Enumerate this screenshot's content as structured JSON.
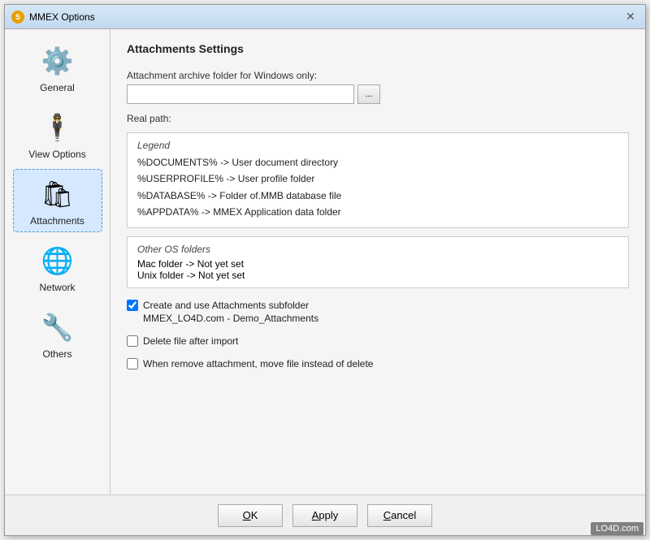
{
  "window": {
    "title": "MMEX Options",
    "close_label": "✕"
  },
  "sidebar": {
    "items": [
      {
        "id": "general",
        "label": "General",
        "icon": "⚙️",
        "active": false
      },
      {
        "id": "view-options",
        "label": "View Options",
        "icon": "🕴",
        "active": false
      },
      {
        "id": "attachments",
        "label": "Attachments",
        "icon": "🛍",
        "active": true
      },
      {
        "id": "network",
        "label": "Network",
        "icon": "🌐",
        "active": false
      },
      {
        "id": "others",
        "label": "Others",
        "icon": "🔧",
        "active": false
      }
    ]
  },
  "content": {
    "title": "Attachments Settings",
    "folder_label": "Attachment archive folder for Windows only:",
    "folder_value": "",
    "folder_placeholder": "",
    "browse_label": "...",
    "real_path_label": "Real path:",
    "legend": {
      "title": "Legend",
      "items": [
        "%DOCUMENTS% -> User document directory",
        "%USERPROFILE% -> User profile folder",
        "%DATABASE% -> Folder of.MMB database file",
        "%APPDATA% -> MMEX Application data folder"
      ]
    },
    "os_folders": {
      "title": "Other OS folders",
      "items": [
        "Mac folder -> Not yet set",
        "Unix folder -> Not yet set"
      ]
    },
    "create_subfolder_checked": true,
    "create_subfolder_label": "Create and use Attachments subfolder",
    "subfolder_path": "MMEX_LO4D.com - Demo_Attachments",
    "delete_after_import_checked": false,
    "delete_after_import_label": "Delete file after import",
    "move_instead_delete_checked": false,
    "move_instead_delete_label": "When remove attachment, move file instead of delete"
  },
  "footer": {
    "ok_label": "OK",
    "apply_label": "Apply",
    "cancel_label": "Cancel"
  },
  "watermark": "LO4D.com"
}
